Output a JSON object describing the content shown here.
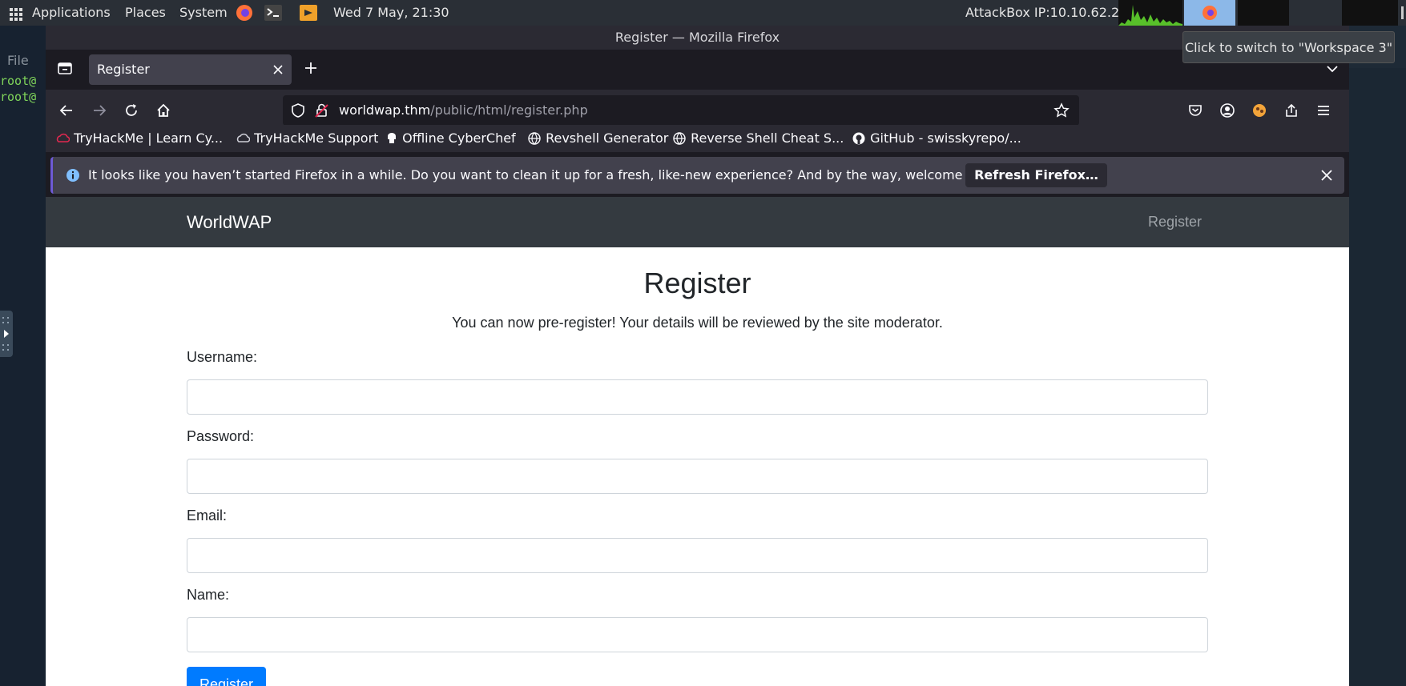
{
  "system_panel": {
    "applications": "Applications",
    "places": "Places",
    "system": "System",
    "clock": "Wed  7 May, 21:30",
    "attackbox_ip": "AttackBox IP:10.10.62.23",
    "workspace_tooltip": "Click to switch to \"Workspace 3\""
  },
  "terminal": {
    "menu_file": "File",
    "lines": [
      "root@",
      "root@"
    ]
  },
  "browser": {
    "window_title": "Register — Mozilla Firefox",
    "tab_title": "Register",
    "url_domain": "worldwap.thm",
    "url_path": "/public/html/register.php",
    "bookmarks": [
      "TryHackMe | Learn Cy...",
      "TryHackMe Support",
      "Offline CyberChef",
      "Revshell Generator",
      "Reverse Shell Cheat S...",
      "GitHub - swisskyrepo/..."
    ],
    "notice_text": "It looks like you haven’t started Firefox in a while. Do you want to clean it up for a fresh, like-new experience? And by the way, welcome back!",
    "notice_button": "Refresh Firefox…"
  },
  "site": {
    "brand": "WorldWAP",
    "nav_register": "Register",
    "heading": "Register",
    "lead": "You can now pre-register! Your details will be reviewed by the site moderator.",
    "fields": [
      {
        "label": "Username:",
        "value": ""
      },
      {
        "label": "Password:",
        "value": ""
      },
      {
        "label": "Email:",
        "value": ""
      },
      {
        "label": "Name:",
        "value": ""
      }
    ],
    "submit": "Register"
  },
  "colors": {
    "primary_button": "#007bff",
    "navbar": "#343a40",
    "firefox_accent": "#6e5ad6"
  }
}
